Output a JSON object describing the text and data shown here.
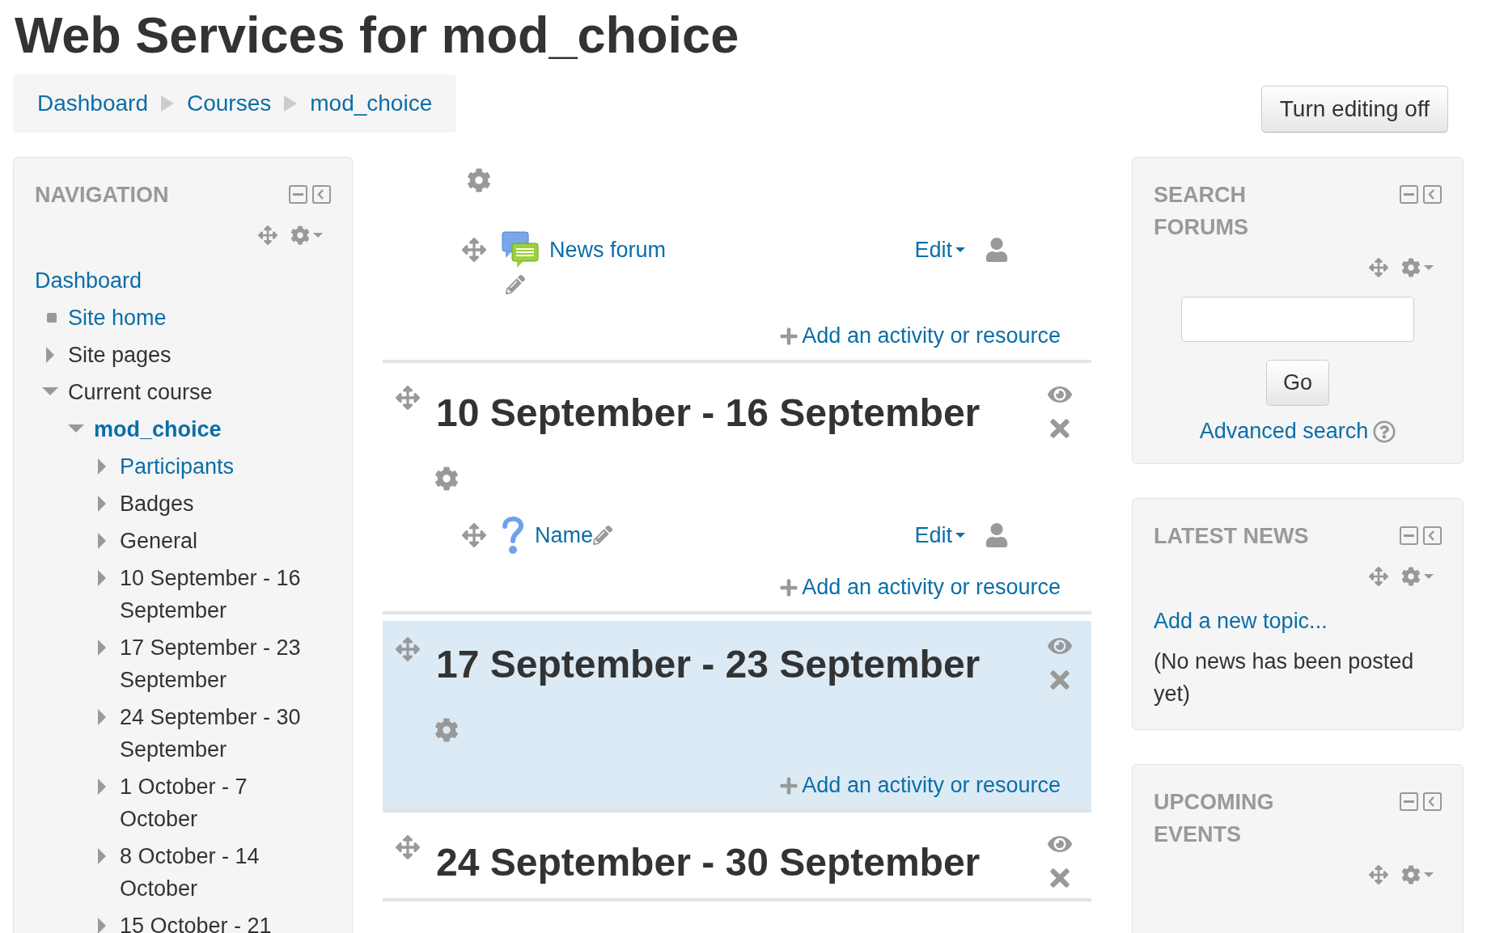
{
  "page_title": "Web Services for mod_choice",
  "breadcrumb": [
    {
      "label": "Dashboard"
    },
    {
      "label": "Courses"
    },
    {
      "label": "mod_choice"
    }
  ],
  "editing_button": "Turn editing off",
  "navigation": {
    "title": "NAVIGATION",
    "items": [
      {
        "label": "Dashboard",
        "kind": "root",
        "link": true,
        "active": false,
        "children": [
          {
            "label": "Site home",
            "kind": "leaf",
            "link": true,
            "active": false
          },
          {
            "label": "Site pages",
            "kind": "branch",
            "expanded": false,
            "link": false,
            "active": false
          },
          {
            "label": "Current course",
            "kind": "branch",
            "expanded": true,
            "link": false,
            "active": false,
            "children": [
              {
                "label": "mod_choice",
                "kind": "branch",
                "expanded": true,
                "link": true,
                "active": true,
                "children": [
                  {
                    "label": "Participants",
                    "kind": "branch",
                    "expanded": false,
                    "link": true,
                    "active": false
                  },
                  {
                    "label": "Badges",
                    "kind": "branch",
                    "expanded": false,
                    "link": false,
                    "active": false
                  },
                  {
                    "label": "General",
                    "kind": "branch",
                    "expanded": false,
                    "link": false,
                    "active": false
                  },
                  {
                    "label": "10 September - 16 September",
                    "kind": "branch",
                    "expanded": false,
                    "link": false,
                    "active": false
                  },
                  {
                    "label": "17 September - 23 September",
                    "kind": "branch",
                    "expanded": false,
                    "link": false,
                    "active": false
                  },
                  {
                    "label": "24 September - 30 September",
                    "kind": "branch",
                    "expanded": false,
                    "link": false,
                    "active": false
                  },
                  {
                    "label": "1 October - 7 October",
                    "kind": "branch",
                    "expanded": false,
                    "link": false,
                    "active": false
                  },
                  {
                    "label": "8 October - 14 October",
                    "kind": "branch",
                    "expanded": false,
                    "link": false,
                    "active": false
                  },
                  {
                    "label": "15 October - 21",
                    "kind": "branch",
                    "expanded": false,
                    "link": false,
                    "active": false
                  }
                ]
              }
            ]
          }
        ]
      }
    ]
  },
  "sections": [
    {
      "current": false,
      "activities": [
        {
          "kind": "forum",
          "name": "News forum",
          "edit": "Edit"
        }
      ],
      "add_label": "Add an activity or resource"
    },
    {
      "title": "10 September - 16 September",
      "current": false,
      "activities": [
        {
          "kind": "question",
          "name": "Name",
          "edit": "Edit"
        }
      ],
      "add_label": "Add an activity or resource"
    },
    {
      "title": "17 September - 23 September",
      "current": true,
      "add_label": "Add an activity or resource"
    },
    {
      "title": "24 September - 30 September",
      "current": false
    }
  ],
  "blocks": [
    {
      "kind": "search",
      "title": "SEARCH FORUMS",
      "button": "Go",
      "link": "Advanced search"
    },
    {
      "kind": "news",
      "title": "LATEST NEWS",
      "link": "Add a new topic...",
      "text": "(No news has been posted yet)"
    },
    {
      "kind": "events",
      "title": "UPCOMING EVENTS"
    }
  ]
}
